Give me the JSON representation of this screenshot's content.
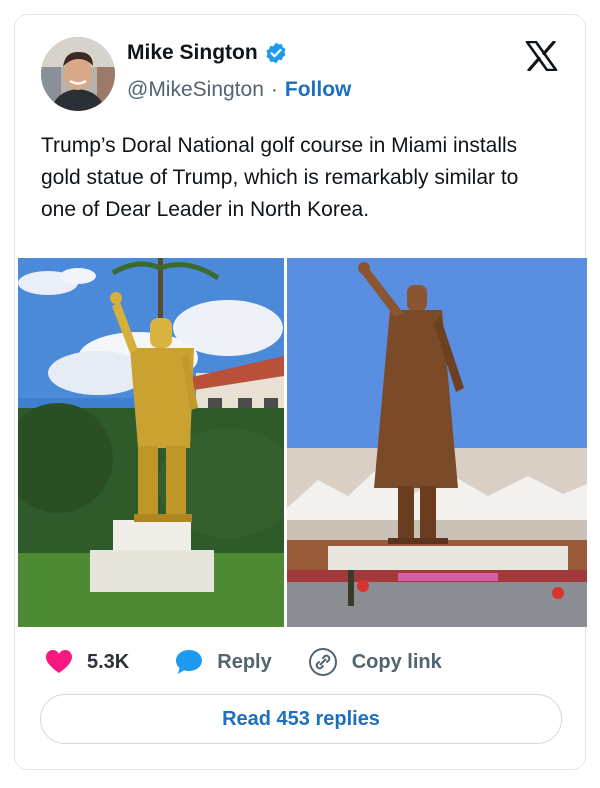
{
  "tweet": {
    "author": {
      "name": "Mike Sington",
      "handle": "@MikeSington",
      "separator": "·",
      "follow_label": "Follow",
      "verified_icon": "verified-badge-icon",
      "verified_color": "#1d9bf0"
    },
    "logo_icon": "x-logo-icon",
    "text": "Trump’s Doral National golf course in Miami installs gold statue of Trump, which is remarkably similar to one of Dear Leader in North Korea.",
    "media": [
      {
        "icon": "gold-statue-photo",
        "description_visible": false
      },
      {
        "icon": "bronze-statue-photo",
        "description_visible": false
      }
    ],
    "actions": {
      "like_count": "5.3K",
      "like_icon": "heart-icon",
      "like_color": "#f91880",
      "reply_label": "Reply",
      "reply_icon": "speech-bubble-icon",
      "reply_color": "#1d9bf0",
      "copy_label": "Copy link",
      "copy_icon": "link-icon"
    },
    "read_replies_label": "Read 453 replies"
  }
}
